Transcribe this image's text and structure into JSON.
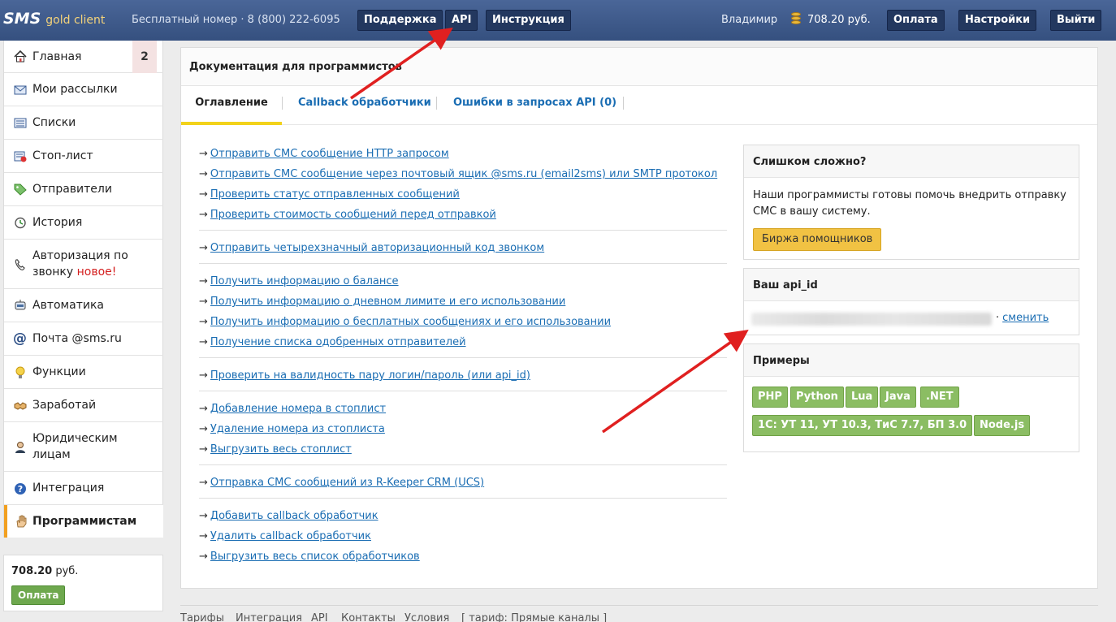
{
  "topbar": {
    "logo_sms": "SMS",
    "logo_gold": "gold client",
    "free_number": "Бесплатный номер · 8 (800) 222-6095",
    "buttons": {
      "support": "Поддержка",
      "api": "API",
      "instructions": "Инструкция",
      "pay": "Оплата",
      "settings": "Настройки",
      "logout": "Выйти"
    },
    "user_name": "Владимир",
    "balance": "708.20 руб."
  },
  "sidebar": {
    "items": [
      {
        "label": "Главная",
        "badge": "2",
        "icon": "home-icon"
      },
      {
        "label": "Мои рассылки",
        "icon": "envelope-icon"
      },
      {
        "label": "Списки",
        "icon": "list-icon"
      },
      {
        "label": "Стоп-лист",
        "icon": "stoplist-icon"
      },
      {
        "label": "Отправители",
        "icon": "tag-icon"
      },
      {
        "label": "История",
        "icon": "history-icon"
      },
      {
        "label_line1": "Авторизация по",
        "label_line2": "звонку",
        "new_label": "новое!",
        "icon": "phone-icon"
      },
      {
        "label": "Автоматика",
        "icon": "robot-icon"
      },
      {
        "label": "Почта @sms.ru",
        "icon": "at-icon"
      },
      {
        "label": "Функции",
        "icon": "bulb-icon"
      },
      {
        "label": "Заработай",
        "icon": "handshake-icon"
      },
      {
        "label_line1": "Юридическим",
        "label_line2": "лицам",
        "icon": "person-icon"
      },
      {
        "label": "Интеграция",
        "icon": "question-icon"
      },
      {
        "label": "Программистам",
        "icon": "hand-icon"
      }
    ],
    "balance_amount": "708.20",
    "balance_currency": "руб.",
    "pay_label": "Оплата"
  },
  "main": {
    "title": "Документация для программистов",
    "tabs": [
      "Оглавление",
      "Callback обработчики",
      "Ошибки в запросах API (0)"
    ],
    "arrow": "→",
    "groups": [
      [
        "Отправить СМС сообщение HTTP запросом",
        "Отправить СМС сообщение через почтовый ящик @sms.ru (email2sms) или SMTP протокол",
        "Проверить статус отправленных сообщений",
        "Проверить стоимость сообщений перед отправкой"
      ],
      [
        "Отправить четырехзначный авторизационный код звонком"
      ],
      [
        "Получить информацию о балансе",
        "Получить информацию о дневном лимите и его использовании",
        "Получить информацию о бесплатных сообщениях и его использовании",
        "Получение списка одобренных отправителей"
      ],
      [
        "Проверить на валидность пару логин/пароль (или api_id)"
      ],
      [
        "Добавление номера в стоплист",
        "Удаление номера из стоплиста",
        "Выгрузить весь стоплист"
      ],
      [
        "Отправка СМС сообщений из R-Keeper CRM (UCS)"
      ],
      [
        "Добавить callback обработчик",
        "Удалить callback обработчик",
        "Выгрузить весь список обработчиков"
      ]
    ]
  },
  "help_box": {
    "title": "Слишком сложно?",
    "text": "Наши программисты готовы помочь внедрить отправку СМС в вашу систему.",
    "button": "Биржа помощников"
  },
  "api_box": {
    "title": "Ваш api_id",
    "separator": "·",
    "change": "сменить"
  },
  "examples_box": {
    "title": "Примеры",
    "row1": [
      "PHP",
      "Python",
      "Lua",
      "Java",
      ".NET"
    ],
    "row2": [
      "1С: УТ 11, УТ 10.3, ТиС 7.7, БП 3.0",
      "Node.js"
    ]
  },
  "footer": {
    "links": [
      "Тарифы",
      "Интеграция",
      "API",
      "Контакты",
      "Условия",
      "[ тариф: Прямые каналы ]"
    ]
  },
  "colors": {
    "topbar": "#3e5a8a",
    "link": "#1a6db3",
    "active_tab": "#f2d21a",
    "annotation_arrow": "#e02020"
  }
}
